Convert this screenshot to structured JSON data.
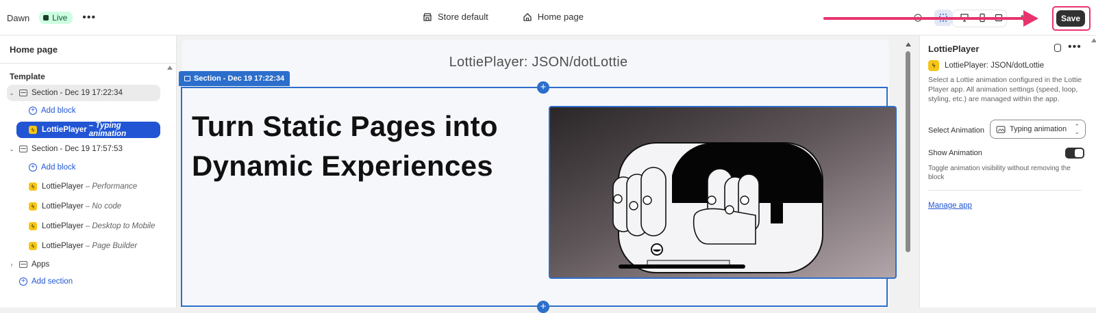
{
  "topbar": {
    "theme_name": "Dawn",
    "live_badge": "Live",
    "store_selector": "Store default",
    "page_selector": "Home page",
    "save_label": "Save"
  },
  "sidebar": {
    "title": "Home page",
    "template_label": "Template",
    "rows": [
      {
        "type": "section",
        "label": "Section - Dec 19 17:22:34"
      },
      {
        "type": "add",
        "label": "Add block"
      },
      {
        "type": "block",
        "name": "LottiePlayer",
        "sub": "– Typing animation"
      },
      {
        "type": "section",
        "label": "Section - Dec 19 17:57:53"
      },
      {
        "type": "add",
        "label": "Add block"
      },
      {
        "type": "block",
        "name": "LottiePlayer",
        "sub": "– Performance"
      },
      {
        "type": "block",
        "name": "LottiePlayer",
        "sub": "– No code"
      },
      {
        "type": "block",
        "name": "LottiePlayer",
        "sub": "– Desktop to Mobile"
      },
      {
        "type": "block",
        "name": "LottiePlayer",
        "sub": "– Page Builder"
      },
      {
        "type": "group",
        "label": "Apps"
      },
      {
        "type": "add-section",
        "label": "Add section"
      }
    ]
  },
  "preview": {
    "heading": "LottiePlayer: JSON/dotLottie",
    "section_tag": "Section - Dec 19 17:22:34",
    "hero_title": "Turn Static Pages into Dynamic Experiences"
  },
  "panel": {
    "title": "LottiePlayer",
    "app_name": "LottiePlayer: JSON/dotLottie",
    "description": "Select a Lottie animation configured in the Lottie Player app. All animation settings (speed, loop, styling, etc.) are managed within the app.",
    "select_label": "Select Animation",
    "select_value": "Typing animation",
    "toggle_label": "Show Animation",
    "toggle_on": true,
    "toggle_help": "Toggle animation visibility without removing the block",
    "manage_link": "Manage app"
  },
  "colors": {
    "accent": "#2c6ecb",
    "selected": "#2155d3",
    "highlight": "#e8336d",
    "live_bg": "#cdfee1"
  }
}
